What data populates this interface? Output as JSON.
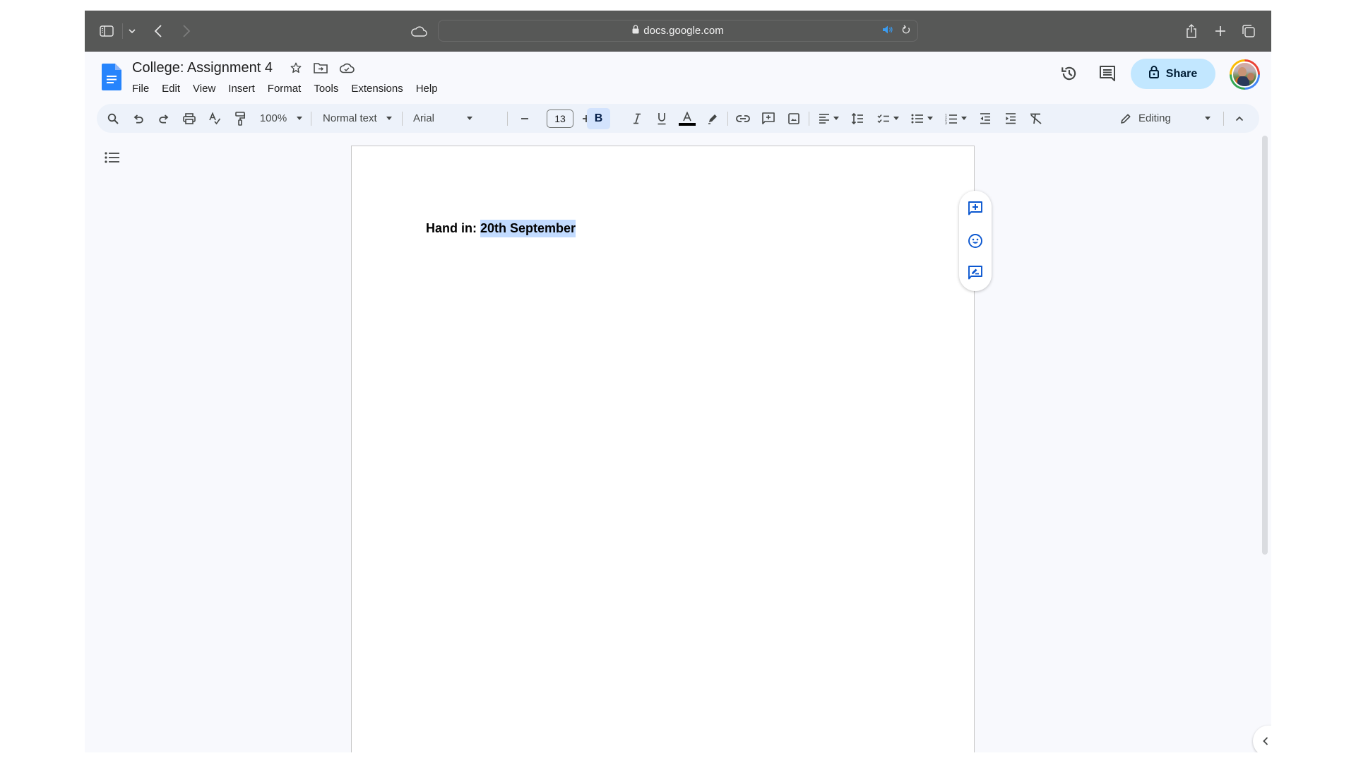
{
  "browser": {
    "url": "docs.google.com",
    "icons": {
      "sidebar": "sidebar-icon",
      "tab_menu": "chevron-down-icon",
      "back": "back-icon",
      "forward": "forward-icon",
      "icloud": "cloud-icon",
      "lock": "lock-icon",
      "audio": "speaker-icon",
      "reload": "reload-icon",
      "share": "share-icon",
      "new_tab": "plus-icon",
      "tab_overview": "tabs-icon"
    }
  },
  "docs": {
    "title": "College: Assignment 4",
    "menu": [
      "File",
      "Edit",
      "View",
      "Insert",
      "Format",
      "Tools",
      "Extensions",
      "Help"
    ],
    "share_label": "Share",
    "accent_color": "#c2e7ff"
  },
  "toolbar": {
    "zoom": "100%",
    "style": "Normal text",
    "font": "Arial",
    "font_size": "13",
    "bold_label": "B",
    "mode": "Editing",
    "bold_active": true
  },
  "document": {
    "text_prefix": "Hand in: ",
    "text_selected": "20th September",
    "selection_color": "#c2dbff"
  },
  "floating_actions": [
    "add-comment",
    "add-emoji-reaction",
    "suggest-edits"
  ]
}
